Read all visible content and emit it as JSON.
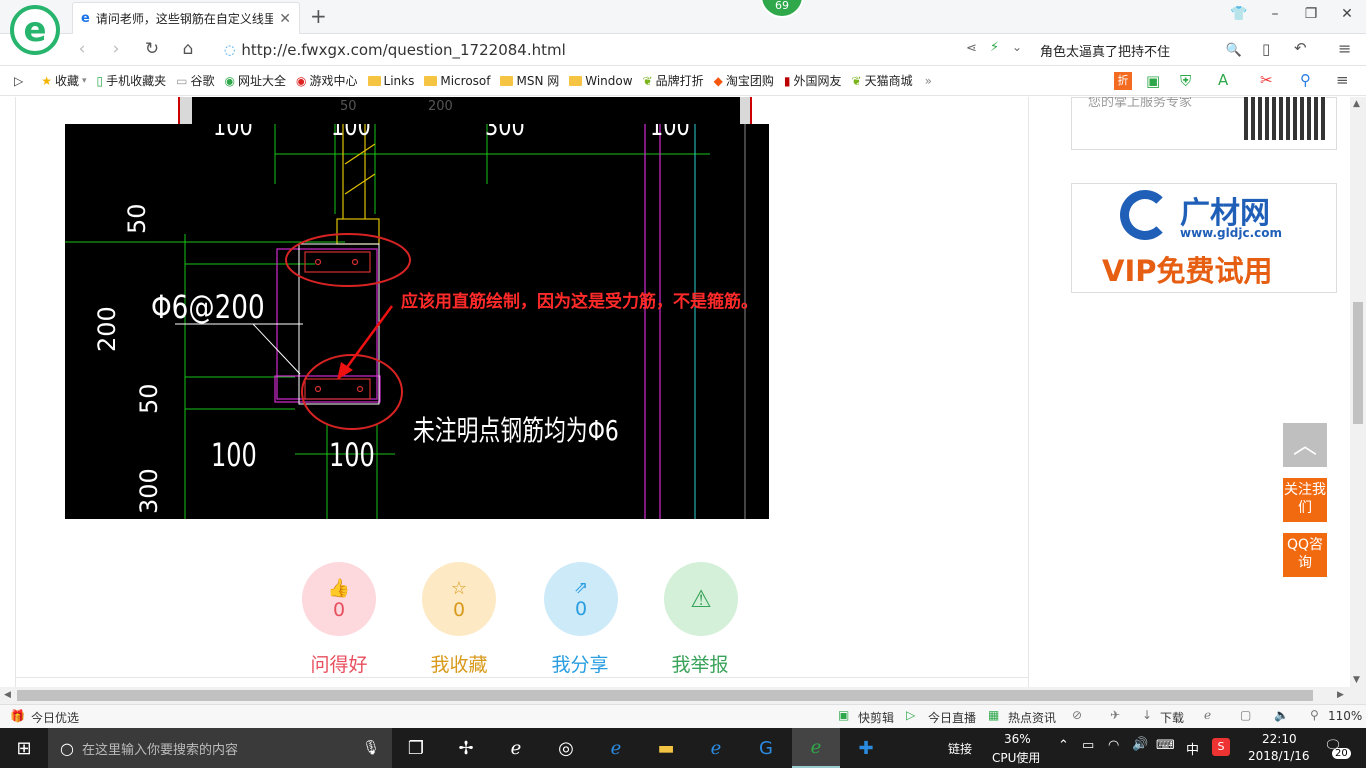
{
  "tab": {
    "title": "请问老师，这些钢筋在自定义线里"
  },
  "badge": {
    "count": "69"
  },
  "nav": {
    "url": "http://e.fwxgx.com/question_1722084.html",
    "search_text": "角色太逼真了把持不住"
  },
  "bookmarks": [
    {
      "label": "收藏",
      "icon": "star-icon"
    },
    {
      "label": "手机收藏夹",
      "icon": "phone-icon"
    },
    {
      "label": "谷歌",
      "icon": "page-icon"
    },
    {
      "label": "网址大全",
      "icon": "globe-icon"
    },
    {
      "label": "游戏中心",
      "icon": "game-icon"
    },
    {
      "label": "Links",
      "icon": "folder-icon"
    },
    {
      "label": "Microsof",
      "icon": "folder-icon"
    },
    {
      "label": "MSN 网",
      "icon": "folder-icon"
    },
    {
      "label": "Window",
      "icon": "folder-icon"
    },
    {
      "label": "品牌打折",
      "icon": "leaf-icon"
    },
    {
      "label": "淘宝团购",
      "icon": "taobao-icon"
    },
    {
      "label": "外国网友",
      "icon": "flag-icon"
    },
    {
      "label": "天猫商城",
      "icon": "leaf-icon"
    }
  ],
  "cad": {
    "top_dims": [
      "50",
      "200"
    ],
    "dims": [
      "100",
      "100",
      "300",
      "100"
    ],
    "side_dims": [
      "50",
      "200",
      "50",
      "300"
    ],
    "rebar_label": "Φ6@200",
    "note": "未注明点钢筋均为Φ6",
    "bottom_dims": [
      "100",
      "100"
    ],
    "annotation": "应该用直筋绘制，因为这是受力筋，不是箍筋。"
  },
  "actions": [
    {
      "label": "问得好",
      "count": "0",
      "icon": "thumbs-up-icon",
      "color": "#e84f5e",
      "bg": "#fdd8dc"
    },
    {
      "label": "我收藏",
      "count": "0",
      "icon": "star-icon",
      "color": "#d99a1c",
      "bg": "#fde9c4"
    },
    {
      "label": "我分享",
      "count": "0",
      "icon": "share-icon",
      "color": "#2a9ee0",
      "bg": "#cdeaf9"
    },
    {
      "label": "我举报",
      "count": "0",
      "icon": "warning-icon",
      "color": "#3aa35a",
      "bg": "#d4f0d9"
    }
  ],
  "sidebar": {
    "service_text": "您的掌上服务专家",
    "ad_brand": "广材网",
    "ad_url": "www.gldjc.com",
    "ad_slogan": "VIP免费试用"
  },
  "float_buttons": {
    "follow": "关注我们",
    "qq": "QQ咨询"
  },
  "status": {
    "left": "今日优选",
    "quick_cut": "快剪辑",
    "live": "今日直播",
    "news": "热点资讯",
    "download": "下载",
    "zoom": "110%"
  },
  "taskbar": {
    "search_placeholder": "在这里输入你要搜索的内容",
    "link": "链接",
    "cpu_percent": "36%",
    "cpu_label": "CPU使用",
    "ime": "中",
    "time": "22:10",
    "date": "2018/1/16",
    "notifications": "20"
  }
}
